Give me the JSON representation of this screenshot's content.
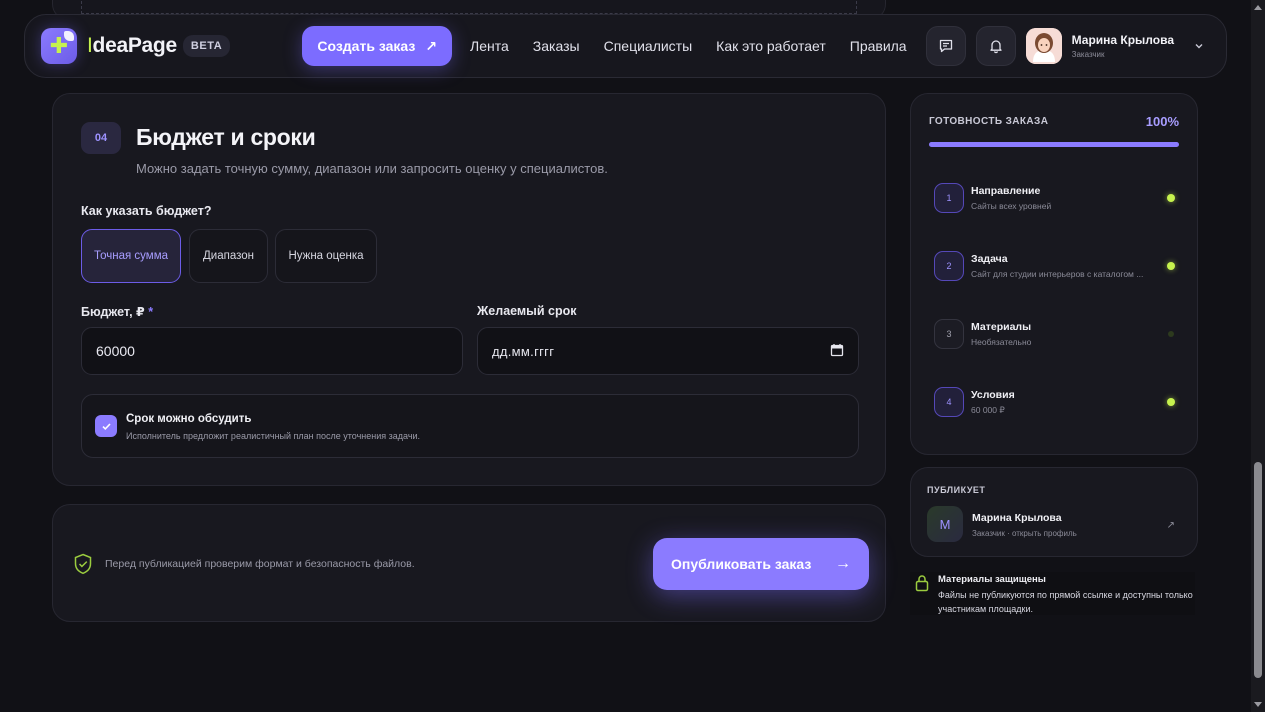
{
  "header": {
    "logo_first": "I",
    "logo_rest": "deaPage",
    "beta": "BETA",
    "create_label": "Создать заказ",
    "create_arrow": "↗",
    "nav": [
      "Лента",
      "Заказы",
      "Специалисты",
      "Как это работает",
      "Правила"
    ],
    "user_name": "Марина Крылова",
    "user_role": "Заказчик"
  },
  "section": {
    "step": "04",
    "title": "Бюджет и сроки",
    "subtitle": "Можно задать точную сумму, диапазон или запросить оценку у специалистов.",
    "budget_question": "Как указать бюджет?",
    "options": [
      "Точная сумма",
      "Диапазон",
      "Нужна оценка"
    ],
    "budget_label": "Бюджет, ₽",
    "required_mark": "*",
    "budget_value": "60000",
    "deadline_label": "Желаемый срок",
    "deadline_placeholder": "дд.мм.гггг",
    "negotiable_title": "Срок можно обсудить",
    "negotiable_sub": "Исполнитель предложит реалистичный план после уточнения задачи."
  },
  "footer": {
    "note": "Перед публикацией проверим формат и безопасность файлов.",
    "publish_label": "Опубликовать заказ",
    "publish_arrow": "→"
  },
  "readiness": {
    "title": "ГОТОВНОСТЬ ЗАКАЗА",
    "percent": "100%",
    "progress": 1.0,
    "steps": [
      {
        "num": "1",
        "name": "Направление",
        "desc": "Сайты всех уровней"
      },
      {
        "num": "2",
        "name": "Задача",
        "desc": "Сайт для студии интерьеров с каталогом ..."
      },
      {
        "num": "3",
        "name": "Материалы",
        "desc": "Необязательно"
      },
      {
        "num": "4",
        "name": "Условия",
        "desc": "60 000 ₽"
      }
    ]
  },
  "publisher": {
    "title": "ПУБЛИКУЕТ",
    "initial": "М",
    "name": "Марина Крылова",
    "sub": "Заказчик · открыть профиль",
    "arrow": "↗"
  },
  "security": {
    "title": "Материалы защищены",
    "text": "Файлы не публикуются по прямой ссылке и доступны только участникам площадки."
  },
  "colors": {
    "accent": "#7c6cff",
    "lime": "#c6f24e",
    "background": "#111116"
  }
}
